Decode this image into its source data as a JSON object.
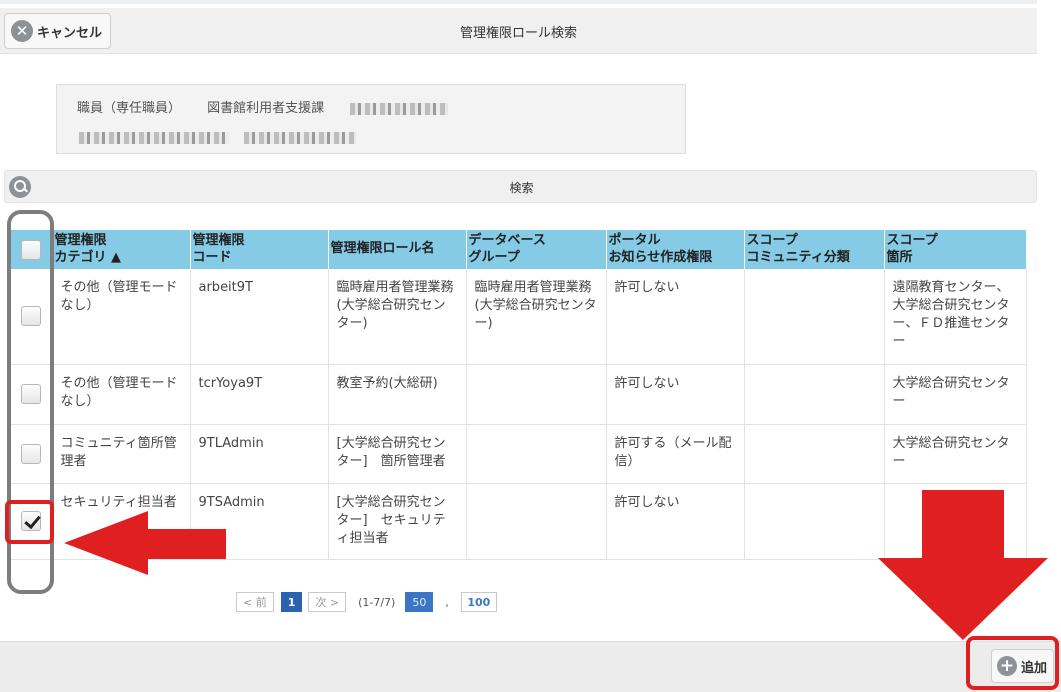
{
  "header": {
    "cancel_label": "キャンセル",
    "title": "管理権限ロール検索"
  },
  "user": {
    "type": "職員（専任職員）",
    "department": "図書館利用者支援課"
  },
  "search": {
    "label": "検索"
  },
  "table": {
    "columns": [
      {
        "line1": "管理権限",
        "line2": "カテゴリ ▲"
      },
      {
        "line1": "管理権限",
        "line2": "コード"
      },
      {
        "line1": "管理権限ロール名",
        "line2": ""
      },
      {
        "line1": "データベース",
        "line2": "グループ"
      },
      {
        "line1": "ポータル",
        "line2": "お知らせ作成権限"
      },
      {
        "line1": "スコープ",
        "line2": "コミュニティ分類"
      },
      {
        "line1": "スコープ",
        "line2": "箇所"
      }
    ],
    "rows": [
      {
        "checked": false,
        "category": "その他（管理モードなし）",
        "code": "arbeit9T",
        "role": "臨時雇用者管理業務(大学総合研究センター)",
        "db_group": "臨時雇用者管理業務(大学総合研究センター)",
        "portal": "許可しない",
        "community": "",
        "scope_place": "遠隔教育センター、大学総合研究センター、ＦＤ推進センター"
      },
      {
        "checked": false,
        "category": "その他（管理モードなし）",
        "code": "tcrYoya9T",
        "role": "教室予約(大総研)",
        "db_group": "",
        "portal": "許可しない",
        "community": "",
        "scope_place": "大学総合研究センター"
      },
      {
        "checked": false,
        "category": "コミュニティ箇所管理者",
        "code": "9TLAdmin",
        "role": "[大学総合研究センター]　箇所管理者",
        "db_group": "",
        "portal": "許可する（メール配信）",
        "community": "",
        "scope_place": "大学総合研究センター"
      },
      {
        "checked": true,
        "category": "セキュリティ担当者",
        "code": "9TSAdmin",
        "role": "[大学総合研究センター]　セキュリティ担当者",
        "db_group": "",
        "portal": "許可しない",
        "community": "",
        "scope_place": ""
      }
    ]
  },
  "pager": {
    "prev": "< 前",
    "current": "1",
    "next": "次 >",
    "info": "(1-7/7)",
    "size_current": "50",
    "separator": ",",
    "size_other": "100"
  },
  "footer": {
    "add_label": "追加"
  },
  "colors": {
    "header_bg": "#86cbe6",
    "annotation_red": "#e02020",
    "annotation_gray": "#7d7d7d"
  }
}
